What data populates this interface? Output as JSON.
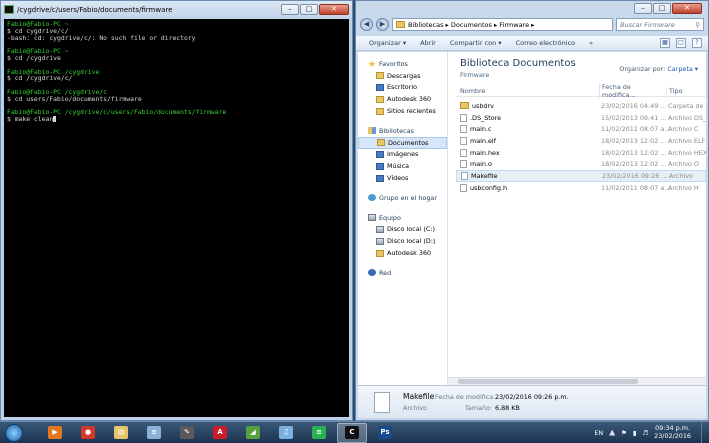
{
  "terminal": {
    "title": "/cygdrive/c/users/Fabio/documents/firmware",
    "lines": [
      {
        "text": "Fabio@Fabio-PC ~",
        "color": "g"
      },
      {
        "text": "$ cd cygdrive/c/",
        "color": ""
      },
      {
        "text": "-bash: cd: cygdrive/c/: No such file or directory",
        "color": ""
      },
      {
        "text": "",
        "color": ""
      },
      {
        "text": "Fabio@Fabio-PC ~",
        "color": "g"
      },
      {
        "text": "$ cd /cygdrive",
        "color": ""
      },
      {
        "text": "",
        "color": ""
      },
      {
        "text": "Fabio@Fabio-PC /cygdrive",
        "color": "g"
      },
      {
        "text": "$ cd /cygdrive/c/",
        "color": ""
      },
      {
        "text": "",
        "color": ""
      },
      {
        "text": "Fabio@Fabio-PC /cygdrive/c",
        "color": "g"
      },
      {
        "text": "$ cd users/Fabio/documents/firmware",
        "color": ""
      },
      {
        "text": "",
        "color": ""
      },
      {
        "text": "Fabio@Fabio-PC /cygdrive/c/users/Fabio/documents/firmware",
        "color": "g"
      },
      {
        "text": "$ make clean",
        "color": ""
      }
    ]
  },
  "explorer": {
    "address": "Bibliotecas  ▸  Documentos  ▸  Firmware  ▸",
    "search_placeholder": "Buscar Firmware",
    "toolbar": [
      "Organizar ▾",
      "Abrir",
      "Compartir con ▾",
      "Correo electrónico",
      "»"
    ],
    "nav": [
      {
        "label": "Favoritos",
        "icon": "ic-star",
        "level": "h"
      },
      {
        "label": "Descargas",
        "icon": "ic-fold",
        "level": "c"
      },
      {
        "label": "Escritorio",
        "icon": "ic-blue",
        "level": "c"
      },
      {
        "label": "Autodesk 360",
        "icon": "ic-fold",
        "level": "c"
      },
      {
        "label": "Sitios recientes",
        "icon": "ic-fold",
        "level": "c"
      },
      {
        "label": "Bibliotecas",
        "icon": "ic-lib",
        "level": "h",
        "gap": true
      },
      {
        "label": "Documentos",
        "icon": "ic-fold",
        "level": "c",
        "selected": true
      },
      {
        "label": "Imágenes",
        "icon": "ic-blue",
        "level": "c"
      },
      {
        "label": "Música",
        "icon": "ic-blue",
        "level": "c"
      },
      {
        "label": "Vídeos",
        "icon": "ic-blue",
        "level": "c"
      },
      {
        "label": "Grupo en el hogar",
        "icon": "ic-grp",
        "level": "h",
        "gap": true
      },
      {
        "label": "Equipo",
        "icon": "ic-drive",
        "level": "h",
        "gap": true
      },
      {
        "label": "Disco local (C:)",
        "icon": "ic-drive",
        "level": "c"
      },
      {
        "label": "Disco local (D:)",
        "icon": "ic-drive",
        "level": "c"
      },
      {
        "label": "Autodesk 360",
        "icon": "ic-fold",
        "level": "c"
      },
      {
        "label": "Red",
        "icon": "ic-net",
        "level": "h",
        "gap": true
      }
    ],
    "library_title": "Biblioteca Documentos",
    "library_sub": "Firmware",
    "arrange_label": "Organizar por:",
    "arrange_value": "Carpeta ▾",
    "columns": [
      "Nombre",
      "Fecha de modifica...",
      "Tipo"
    ],
    "files": [
      {
        "name": "usbdrv",
        "date": "23/02/2016 04:49 ...",
        "type": "Carpeta de a",
        "folder": true
      },
      {
        "name": ".DS_Store",
        "date": "15/02/2013 09:41 ...",
        "type": "Archivo DS_S"
      },
      {
        "name": "main.c",
        "date": "11/02/2011 08:07 a...",
        "type": "Archivo C"
      },
      {
        "name": "main.elf",
        "date": "18/02/2013 12:02 ...",
        "type": "Archivo ELF"
      },
      {
        "name": "main.hex",
        "date": "18/02/2013 12:02 ...",
        "type": "Archivo HEX"
      },
      {
        "name": "main.o",
        "date": "18/02/2013 12:02 ...",
        "type": "Archivo O"
      },
      {
        "name": "Makefile",
        "date": "23/02/2016 09:26 ...",
        "type": "Archivo",
        "selected": true
      },
      {
        "name": "usbconfig.h",
        "date": "11/02/2011 08:07 a...",
        "type": "Archivo H"
      }
    ],
    "details": {
      "name": "Makefile",
      "type": "Archivo",
      "date_label": "Fecha de modifica...:",
      "date_value": "23/02/2016 09:26 p.m.",
      "size_label": "Tamaño:",
      "size_value": "6,88 KB"
    }
  },
  "taskbar": {
    "apps": [
      {
        "name": "media-player",
        "color": "#e07820",
        "glyph": "▶"
      },
      {
        "name": "chrome",
        "color": "#d0392b",
        "glyph": "●"
      },
      {
        "name": "explorer",
        "color": "#e8c56a",
        "glyph": "▤"
      },
      {
        "name": "notepad",
        "color": "#8ab0d8",
        "glyph": "≡"
      },
      {
        "name": "inkscape",
        "color": "#5a5a5a",
        "glyph": "✎"
      },
      {
        "name": "autocad",
        "color": "#c8202a",
        "glyph": "A"
      },
      {
        "name": "sketchup",
        "color": "#58a040",
        "glyph": "◢"
      },
      {
        "name": "itunes",
        "color": "#7ab0e0",
        "glyph": "♫"
      },
      {
        "name": "spotify",
        "color": "#2ab050",
        "glyph": "≡"
      },
      {
        "name": "cygwin-terminal",
        "color": "#111111",
        "glyph": "C",
        "active": true
      },
      {
        "name": "photoshop",
        "color": "#1a4a8a",
        "glyph": "Ps"
      }
    ],
    "lang": "EN",
    "time": "09:34 p.m.",
    "date": "23/02/2016"
  }
}
